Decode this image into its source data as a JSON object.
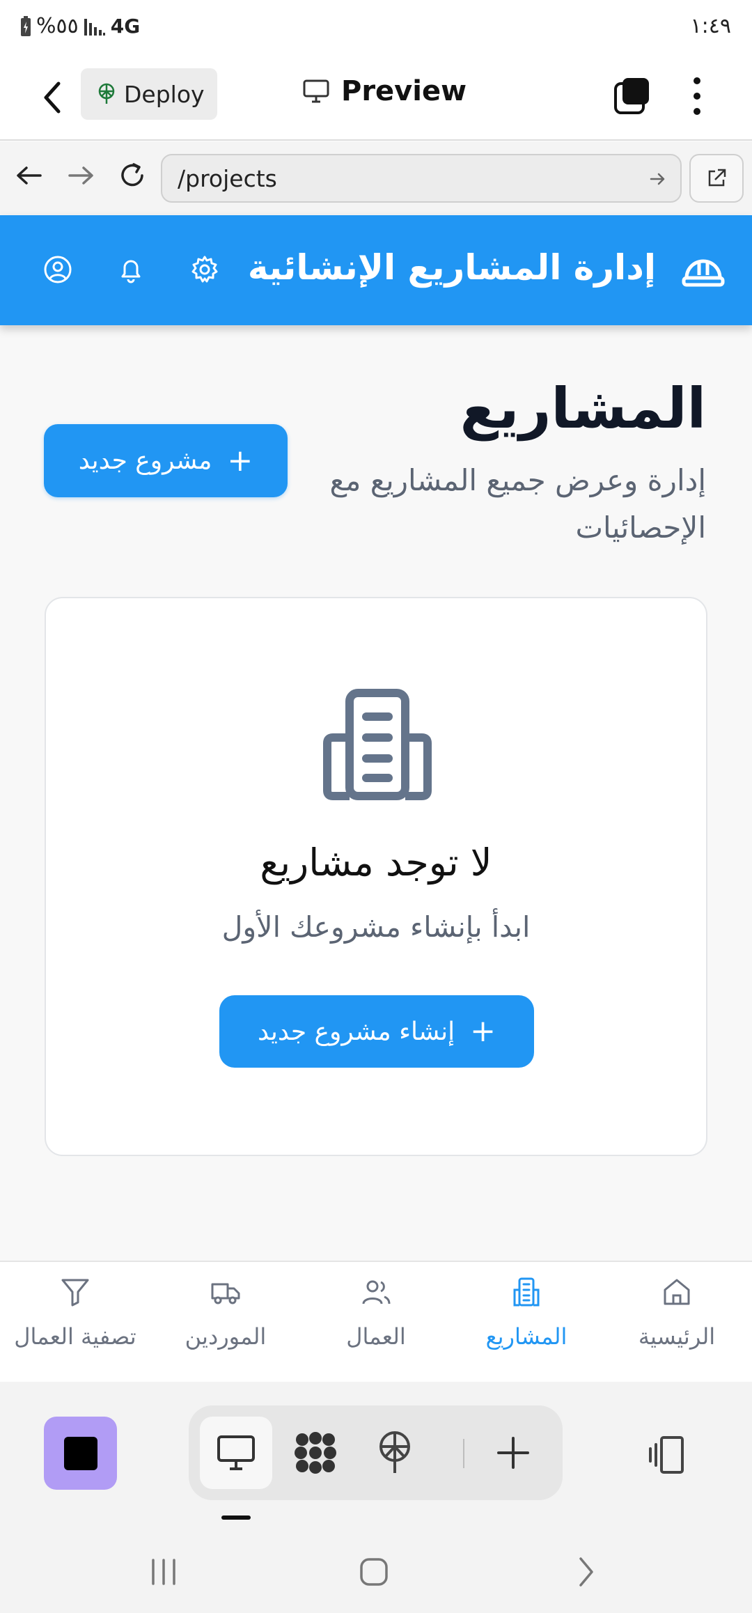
{
  "status_bar": {
    "battery": "%٥٥",
    "network": "4G",
    "time": "١:٤٩"
  },
  "top_bar": {
    "deploy_label": "Deploy",
    "preview_label": "Preview"
  },
  "url_bar": {
    "url": "/projects"
  },
  "header": {
    "title": "إدارة المشاريع الإنشائية"
  },
  "page": {
    "title": "المشاريع",
    "subtitle": "إدارة وعرض جميع المشاريع مع الإحصائيات",
    "new_project_button": "مشروع جديد"
  },
  "empty_state": {
    "title": "لا توجد مشاريع",
    "subtitle": "ابدأ بإنشاء مشروعك الأول",
    "create_button": "إنشاء مشروع جديد"
  },
  "bottom_nav": {
    "items": [
      {
        "label": "الرئيسية",
        "icon": "home-icon"
      },
      {
        "label": "المشاريع",
        "icon": "building-icon",
        "active": true
      },
      {
        "label": "العمال",
        "icon": "users-icon"
      },
      {
        "label": "الموردين",
        "icon": "truck-icon"
      },
      {
        "label": "تصفية العمال",
        "icon": "filter-icon"
      }
    ]
  },
  "colors": {
    "primary": "#2196f3",
    "header_text": "#ffffff",
    "muted_text": "#5b6473",
    "dev_purple": "#b19cf5"
  }
}
